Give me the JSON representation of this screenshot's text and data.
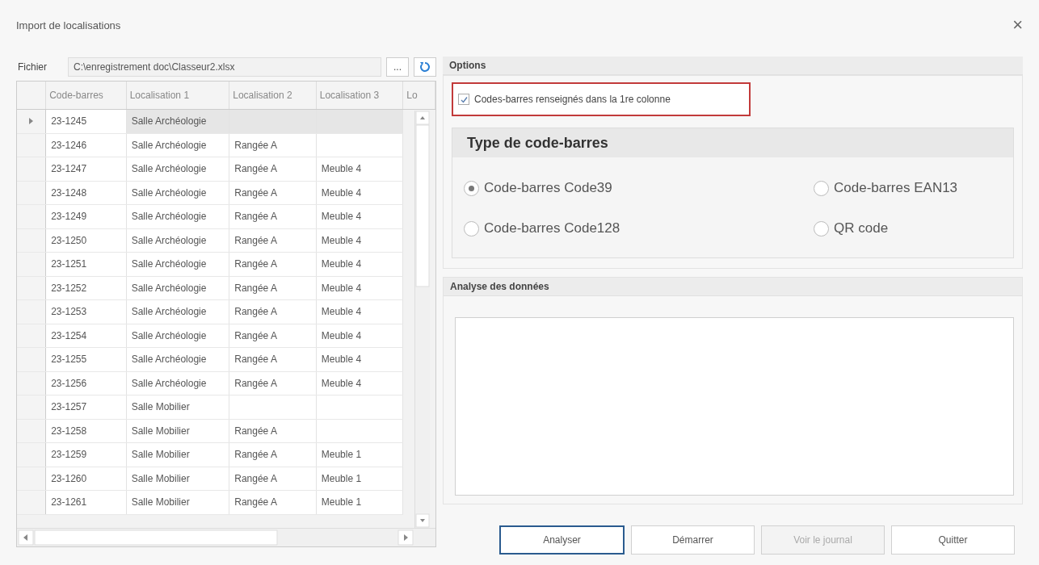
{
  "window": {
    "title": "Import de localisations",
    "close": "×"
  },
  "file": {
    "label": "Fichier",
    "value": "C:\\enregistrement doc\\Classeur2.xlsx",
    "browse": "..."
  },
  "table": {
    "columns": [
      "Code-barres",
      "Localisation 1",
      "Localisation 2",
      "Localisation 3",
      "Lo"
    ],
    "rows": [
      {
        "selected": true,
        "cells": [
          "23-1245",
          "Salle Archéologie",
          "",
          ""
        ]
      },
      {
        "selected": false,
        "cells": [
          "23-1246",
          "Salle Archéologie",
          "Rangée A",
          ""
        ]
      },
      {
        "selected": false,
        "cells": [
          "23-1247",
          "Salle Archéologie",
          "Rangée A",
          "Meuble 4"
        ]
      },
      {
        "selected": false,
        "cells": [
          "23-1248",
          "Salle Archéologie",
          "Rangée A",
          "Meuble 4"
        ]
      },
      {
        "selected": false,
        "cells": [
          "23-1249",
          "Salle Archéologie",
          "Rangée A",
          "Meuble 4"
        ]
      },
      {
        "selected": false,
        "cells": [
          "23-1250",
          "Salle Archéologie",
          "Rangée A",
          "Meuble 4"
        ]
      },
      {
        "selected": false,
        "cells": [
          "23-1251",
          "Salle Archéologie",
          "Rangée A",
          "Meuble 4"
        ]
      },
      {
        "selected": false,
        "cells": [
          "23-1252",
          "Salle Archéologie",
          "Rangée A",
          "Meuble 4"
        ]
      },
      {
        "selected": false,
        "cells": [
          "23-1253",
          "Salle Archéologie",
          "Rangée A",
          "Meuble 4"
        ]
      },
      {
        "selected": false,
        "cells": [
          "23-1254",
          "Salle Archéologie",
          "Rangée A",
          "Meuble 4"
        ]
      },
      {
        "selected": false,
        "cells": [
          "23-1255",
          "Salle Archéologie",
          "Rangée A",
          "Meuble 4"
        ]
      },
      {
        "selected": false,
        "cells": [
          "23-1256",
          "Salle Archéologie",
          "Rangée A",
          "Meuble 4"
        ]
      },
      {
        "selected": false,
        "cells": [
          "23-1257",
          "Salle Mobilier",
          "",
          ""
        ]
      },
      {
        "selected": false,
        "cells": [
          "23-1258",
          "Salle Mobilier",
          "Rangée A",
          ""
        ]
      },
      {
        "selected": false,
        "cells": [
          "23-1259",
          "Salle Mobilier",
          "Rangée A",
          "Meuble 1"
        ]
      },
      {
        "selected": false,
        "cells": [
          "23-1260",
          "Salle Mobilier",
          "Rangée A",
          "Meuble 1"
        ]
      },
      {
        "selected": false,
        "cells": [
          "23-1261",
          "Salle Mobilier",
          "Rangée A",
          "Meuble 1"
        ]
      }
    ]
  },
  "options": {
    "title": "Options",
    "checkbox": {
      "label": "Codes-barres renseignés dans la 1re colonne",
      "checked": true
    },
    "barcode_type": {
      "title": "Type de code-barres",
      "radios": [
        {
          "label": "Code-barres Code39",
          "selected": true
        },
        {
          "label": "Code-barres EAN13",
          "selected": false
        },
        {
          "label": "Code-barres Code128",
          "selected": false
        },
        {
          "label": "QR code",
          "selected": false
        }
      ]
    }
  },
  "analysis": {
    "title": "Analyse des données"
  },
  "buttons": [
    {
      "label": "Analyser",
      "focused": true,
      "disabled": false
    },
    {
      "label": "Démarrer",
      "focused": false,
      "disabled": false
    },
    {
      "label": "Voir le journal",
      "focused": false,
      "disabled": true
    },
    {
      "label": "Quitter",
      "focused": false,
      "disabled": false
    }
  ]
}
